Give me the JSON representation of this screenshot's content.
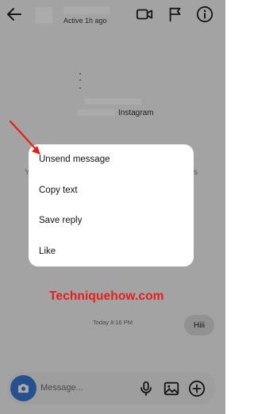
{
  "header": {
    "active_status": "Active 1h ago"
  },
  "profile": {
    "platform_text": "Instagram"
  },
  "menu": {
    "items": [
      {
        "label": "Unsend message"
      },
      {
        "label": "Copy text"
      },
      {
        "label": "Save reply"
      },
      {
        "label": "Like"
      }
    ]
  },
  "background_peek": {
    "left": "Y",
    "right": "s"
  },
  "watermark": "Techniquehow.com",
  "conversation": {
    "timestamp": "Today 8:16 PM",
    "messages": [
      {
        "text": "Hiii"
      }
    ]
  },
  "composer": {
    "placeholder": "Message..."
  },
  "colors": {
    "accent": "#3a78d4",
    "arrow": "#e51d1d",
    "watermark": "#e51d1d"
  },
  "icons": [
    "back-arrow-icon",
    "video-call-icon",
    "flag-icon",
    "info-icon",
    "camera-icon",
    "microphone-icon",
    "gallery-icon",
    "plus-icon"
  ]
}
